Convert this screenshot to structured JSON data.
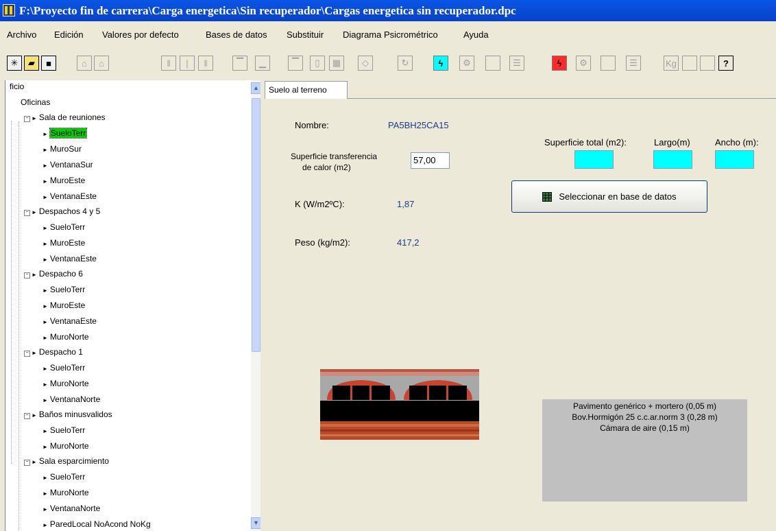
{
  "window": {
    "title": "F:\\Proyecto fin de carrera\\Carga energetica\\Sin recuperador\\Cargas energetica sin recuperador.dpc"
  },
  "menu": [
    "Archivo",
    "Edición",
    "Valores por defecto",
    "Bases de datos",
    "Substituir",
    "Diagrama Psicrométrico",
    "Ayuda"
  ],
  "toolbar": {
    "kg_label": "Kg",
    "help_label": "?"
  },
  "tree": {
    "items": [
      {
        "label": "ficio",
        "level": 0
      },
      {
        "label": "Oficinas",
        "level": 0
      },
      {
        "label": "Sala de reuniones",
        "level": 1
      },
      {
        "label": "SueloTerr",
        "level": 2,
        "selected": true
      },
      {
        "label": "MuroSur",
        "level": 2
      },
      {
        "label": "VentanaSur",
        "level": 2
      },
      {
        "label": "MuroEste",
        "level": 2
      },
      {
        "label": "VentanaEste",
        "level": 2
      },
      {
        "label": "Despachos 4 y 5",
        "level": 1
      },
      {
        "label": "SueloTerr",
        "level": 2
      },
      {
        "label": "MuroEste",
        "level": 2
      },
      {
        "label": "VentanaEste",
        "level": 2
      },
      {
        "label": "Despacho 6",
        "level": 1
      },
      {
        "label": "SueloTerr",
        "level": 2
      },
      {
        "label": "MuroEste",
        "level": 2
      },
      {
        "label": "VentanaEste",
        "level": 2
      },
      {
        "label": "MuroNorte",
        "level": 2
      },
      {
        "label": "Despacho 1",
        "level": 1
      },
      {
        "label": "SueloTerr",
        "level": 2
      },
      {
        "label": "MuroNorte",
        "level": 2
      },
      {
        "label": "VentanaNorte",
        "level": 2
      },
      {
        "label": "Baños minusvalidos",
        "level": 1
      },
      {
        "label": "SueloTerr",
        "level": 2
      },
      {
        "label": "MuroNorte",
        "level": 2
      },
      {
        "label": "Sala esparcimiento",
        "level": 1
      },
      {
        "label": "SueloTerr",
        "level": 2
      },
      {
        "label": "MuroNorte",
        "level": 2
      },
      {
        "label": "VentanaNorte",
        "level": 2
      },
      {
        "label": "ParedLocal NoAcond NoKg",
        "level": 2
      }
    ]
  },
  "tab": {
    "label": "Suelo al terreno"
  },
  "form": {
    "nombre_label": "Nombre:",
    "nombre_value": "PA5BH25CA15",
    "superficie_label_1": "Superficie transferencia",
    "superficie_label_2": "de calor  (m2)",
    "superficie_value": "57,00",
    "k_label": "K (W/m2ºC):",
    "k_value": "1,87",
    "peso_label": "Peso (kg/m2):",
    "peso_value": "417,2",
    "sup_total_label": "Superficie total (m2):",
    "largo_label": "Largo(m)",
    "ancho_label": "Ancho (m):",
    "db_button_label": "Seleccionar en base de datos"
  },
  "layers": [
    "Pavimento genérico + mortero (0,05 m)",
    "Bov.Hormigón 25 c.c.ar.norm 3 (0,28 m)",
    "Cámara de aire (0,15 m)"
  ]
}
